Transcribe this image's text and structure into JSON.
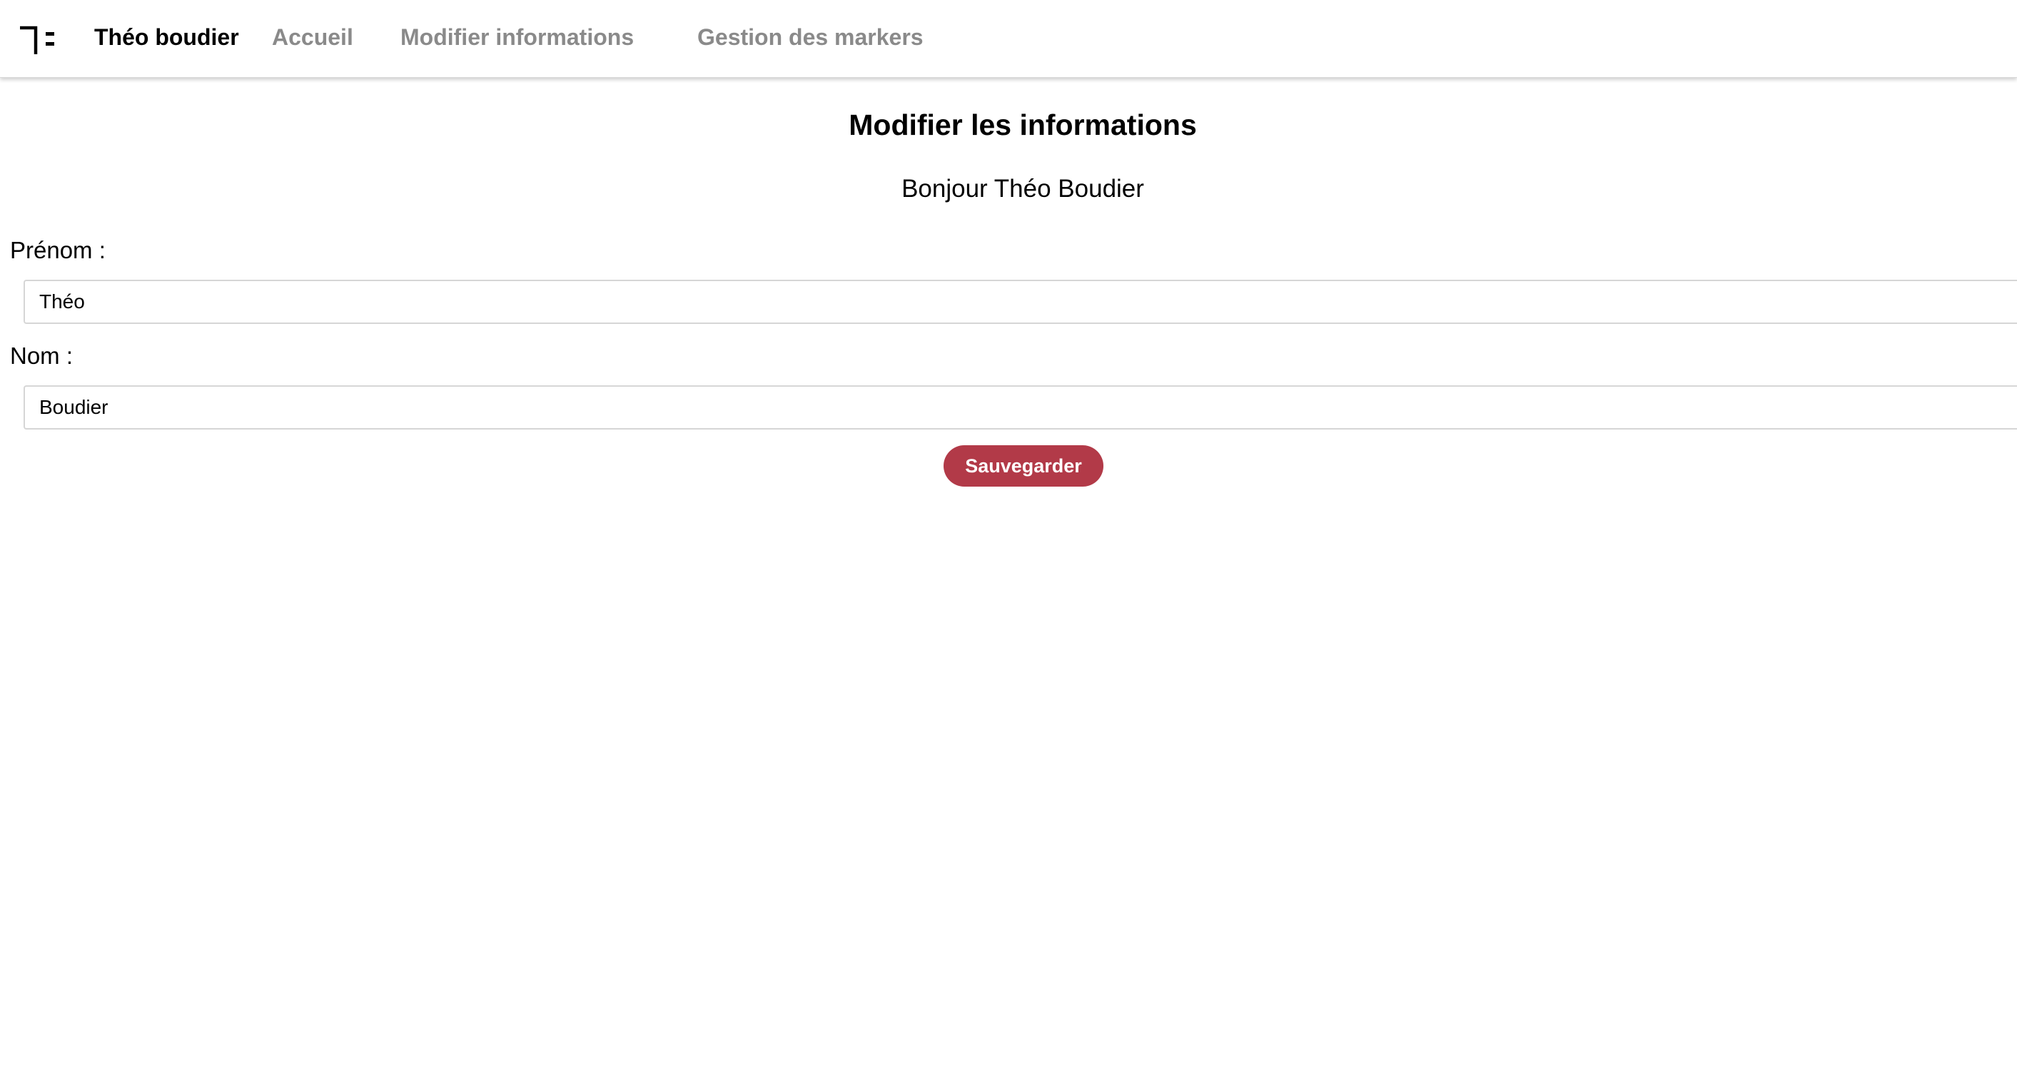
{
  "header": {
    "logo_icon": "brand-logo-icon",
    "brand_name": "Théo boudier",
    "nav": [
      {
        "label": "Accueil"
      },
      {
        "label": "Modifier informations"
      },
      {
        "label": "Gestion des markers"
      }
    ]
  },
  "main": {
    "title": "Modifier les informations",
    "greeting": "Bonjour Théo Boudier",
    "fields": [
      {
        "label": "Prénom :",
        "value": "Théo"
      },
      {
        "label": "Nom :",
        "value": "Boudier"
      }
    ],
    "save_label": "Sauvegarder"
  },
  "colors": {
    "accent": "#b23a48",
    "nav_inactive": "#8a8a8a",
    "input_border": "#d6d6d6"
  }
}
